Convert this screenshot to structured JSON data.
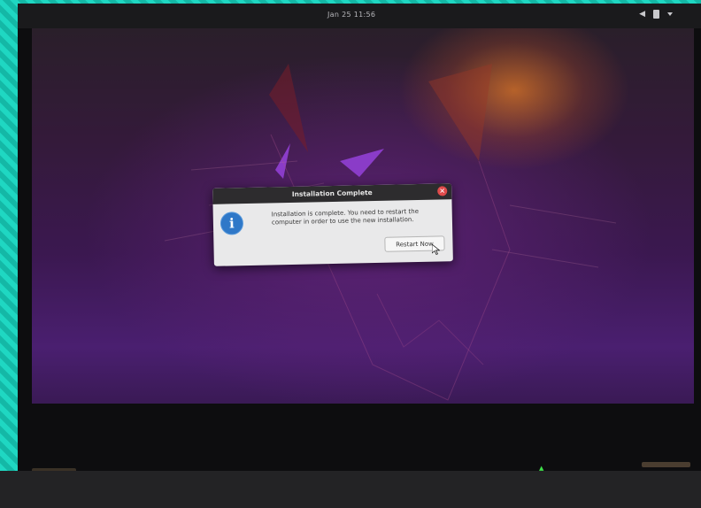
{
  "topbar": {
    "clock": "Jan 25  11:56",
    "tray_icons": [
      "volume-icon",
      "battery-icon",
      "system-menu-chevron-icon"
    ]
  },
  "dialog": {
    "title": "Installation Complete",
    "message": "Installation is complete. You need to restart the computer in order to use the new installation.",
    "restart_button": "Restart Now",
    "icon": "info-icon",
    "close_icon": "close-icon"
  },
  "colors": {
    "dialog_header": "#2d2c2e",
    "dialog_body": "#e9e9ea",
    "close_button": "#e04b4b",
    "info_icon": "#2f78c8",
    "wallpaper_purple": "#3b1850",
    "frame_teal": "#17c9b5"
  }
}
